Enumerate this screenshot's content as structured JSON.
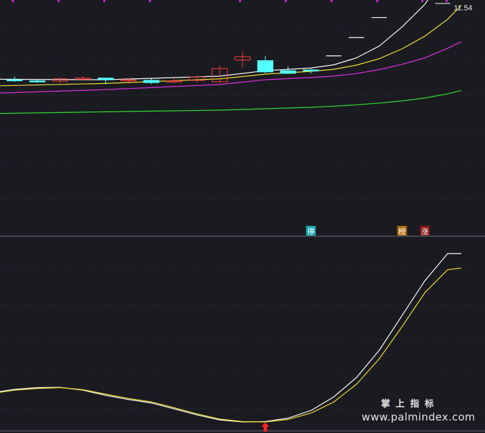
{
  "chart_data": [
    {
      "type": "candlestick",
      "panel": "main",
      "price_label": "11.54",
      "x": [
        1,
        2,
        3,
        4,
        5,
        6,
        7,
        8,
        9,
        10,
        11,
        12,
        13,
        14,
        15,
        16,
        17,
        18,
        19,
        20
      ],
      "ohlc": [
        {
          "o": 5.6,
          "h": 5.72,
          "l": 5.52,
          "c": 5.57
        },
        {
          "o": 5.56,
          "h": 5.62,
          "l": 5.5,
          "c": 5.53
        },
        {
          "o": 5.55,
          "h": 5.68,
          "l": 5.48,
          "c": 5.63
        },
        {
          "o": 5.62,
          "h": 5.72,
          "l": 5.57,
          "c": 5.66
        },
        {
          "o": 5.66,
          "h": 5.66,
          "l": 5.43,
          "c": 5.6
        },
        {
          "o": 5.6,
          "h": 5.66,
          "l": 5.45,
          "c": 5.6
        },
        {
          "o": 5.58,
          "h": 5.64,
          "l": 5.45,
          "c": 5.5
        },
        {
          "o": 5.56,
          "h": 5.64,
          "l": 5.48,
          "c": 5.56
        },
        {
          "o": 5.58,
          "h": 5.75,
          "l": 5.5,
          "c": 5.7
        },
        {
          "o": 5.53,
          "h": 6.1,
          "l": 5.5,
          "c": 6.0
        },
        {
          "o": 6.3,
          "h": 6.6,
          "l": 6.05,
          "c": 6.42
        },
        {
          "o": 6.28,
          "h": 6.45,
          "l": 5.83,
          "c": 5.88
        },
        {
          "o": 5.92,
          "h": 6.08,
          "l": 5.8,
          "c": 5.83
        },
        {
          "o": 5.95,
          "h": 6.0,
          "l": 5.82,
          "c": 5.93
        },
        {
          "o": 6.45,
          "h": 6.45,
          "l": 6.45,
          "c": 6.45
        },
        {
          "o": 7.1,
          "h": 7.1,
          "l": 7.1,
          "c": 7.1
        },
        {
          "o": 7.81,
          "h": 7.81,
          "l": 7.81,
          "c": 7.81
        },
        {
          "o": 8.59,
          "h": 8.59,
          "l": 8.59,
          "c": 8.59
        },
        {
          "o": 9.45,
          "h": 9.45,
          "l": 9.45,
          "c": 9.45
        },
        {
          "o": 10.4,
          "h": 10.4,
          "l": 10.4,
          "c": 10.4
        }
      ],
      "series": [
        {
          "color": "#ffffff",
          "x": [
            0,
            5,
            10,
            12,
            14,
            15,
            16,
            17,
            18,
            19,
            20,
            20.6
          ],
          "values": [
            5.62,
            5.6,
            5.73,
            5.92,
            6.02,
            6.13,
            6.38,
            6.8,
            7.48,
            8.28,
            9.5,
            10.45
          ]
        },
        {
          "color": "#f0e030",
          "x": [
            0,
            5,
            10,
            12,
            14,
            15,
            16,
            17,
            18,
            19,
            20,
            20.6
          ],
          "values": [
            5.38,
            5.47,
            5.63,
            5.8,
            5.9,
            5.97,
            6.12,
            6.35,
            6.7,
            7.15,
            7.75,
            8.25
          ]
        },
        {
          "color": "#e030e0",
          "x": [
            0,
            5,
            10,
            12,
            14,
            15,
            16,
            17,
            18,
            19,
            20,
            20.6
          ],
          "values": [
            5.12,
            5.25,
            5.43,
            5.6,
            5.68,
            5.73,
            5.82,
            5.96,
            6.15,
            6.38,
            6.72,
            6.95
          ]
        },
        {
          "color": "#30e030",
          "x": [
            0,
            5,
            10,
            12,
            14,
            15,
            16,
            17,
            18,
            19,
            20,
            20.6
          ],
          "values": [
            4.4,
            4.46,
            4.52,
            4.57,
            4.62,
            4.66,
            4.71,
            4.77,
            4.85,
            4.95,
            5.1,
            5.22
          ]
        }
      ],
      "markers": [
        {
          "x": 14,
          "label": "停",
          "color": "#1aa7b0"
        },
        {
          "x": 18,
          "label": "榜",
          "color": "#b06a10"
        },
        {
          "x": 19,
          "label": "涨",
          "color": "#8a1515"
        }
      ]
    },
    {
      "type": "line",
      "panel": "indicator",
      "ylim": [
        0,
        100
      ],
      "series": [
        {
          "color": "#ffffff",
          "x": [
            0,
            1,
            2,
            3,
            4,
            5,
            6,
            7,
            8,
            9,
            10,
            11,
            12,
            13,
            14,
            15,
            16,
            17,
            18,
            19,
            20,
            20.6
          ],
          "values": [
            18.0,
            20.0,
            21.0,
            21.2,
            19.5,
            16.5,
            14.0,
            12.0,
            8.5,
            5.0,
            2.0,
            0.8,
            1.0,
            3.0,
            7.5,
            15.5,
            27.0,
            43.0,
            63.5,
            84.0,
            100,
            100
          ]
        },
        {
          "color": "#f0e030",
          "x": [
            0,
            1,
            2,
            3,
            4,
            5,
            6,
            7,
            8,
            9,
            10,
            11,
            12,
            13,
            14,
            15,
            16,
            17,
            18,
            19,
            20,
            20.6
          ],
          "values": [
            17.5,
            19.5,
            20.5,
            21.0,
            19.8,
            17.2,
            14.6,
            12.6,
            9.2,
            5.6,
            2.5,
            1.0,
            0.8,
            2.3,
            6.0,
            12.5,
            23.0,
            38.0,
            57.0,
            77.0,
            90.5,
            91.5
          ]
        }
      ],
      "markers": [
        {
          "x": 12,
          "type": "arrow-up",
          "color": "#ff2020"
        }
      ]
    }
  ],
  "watermark": {
    "cn": "掌上指标",
    "url": "www.palmindex.com"
  }
}
